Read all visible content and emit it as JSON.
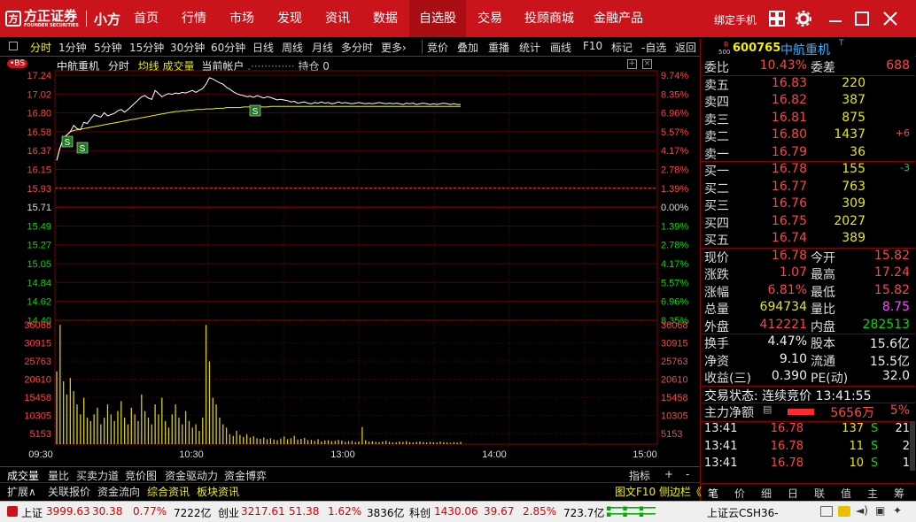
{
  "app": {
    "brand": "方正证券",
    "brand_en": "FOUNDER SECURITIES",
    "sub": "小方"
  },
  "nav": [
    "首页",
    "行情",
    "市场",
    "发现",
    "资讯",
    "数据",
    "自选股",
    "交易",
    "投顾商城",
    "金融产品"
  ],
  "nav_active": 6,
  "topright": {
    "bind_phone": "绑定手机"
  },
  "toolbar": {
    "left": [
      "分时",
      "1分钟",
      "5分钟",
      "15分钟",
      "30分钟",
      "60分钟",
      "日线",
      "周线",
      "月线",
      "多分时",
      "更多›"
    ],
    "right": [
      "竞价",
      "叠加",
      "重播",
      "统计",
      "画线",
      "F10",
      "标记",
      "-自选",
      "返回"
    ]
  },
  "chart_header": {
    "name": "中航重机",
    "mode": "分时",
    "avg": "均线",
    "vol": "成交量",
    "acct": "当前帐户",
    "pos": "持仓 0"
  },
  "chart_data": {
    "type": "line",
    "price_ticks": [
      "17.24",
      "17.02",
      "16.80",
      "16.58",
      "16.37",
      "16.15",
      "15.93",
      "15.71",
      "15.49",
      "15.27",
      "15.05",
      "14.84",
      "14.62",
      "14.40"
    ],
    "pct_ticks": [
      "9.74%",
      "8.35%",
      "6.96%",
      "5.57%",
      "4.17%",
      "2.78%",
      "1.39%",
      "0.00%",
      "1.39%",
      "2.78%",
      "4.17%",
      "5.57%",
      "6.96%",
      "8.35%"
    ],
    "vol_ticks": [
      "36068",
      "30915",
      "25763",
      "20610",
      "15458",
      "10305",
      "5153"
    ],
    "time_ticks": [
      "09:30",
      "10:30",
      "13:00",
      "14:00",
      "15:00"
    ],
    "prev_close": 15.71,
    "price_range": [
      14.18,
      17.24
    ],
    "price": [
      15.9,
      16.1,
      16.25,
      16.3,
      16.35,
      16.45,
      16.4,
      16.38,
      16.5,
      16.48,
      16.55,
      16.62,
      16.6,
      16.58,
      16.65,
      16.6,
      16.62,
      16.64,
      16.68,
      16.7,
      16.66,
      16.7,
      16.75,
      16.8,
      16.85,
      16.9,
      16.92,
      16.88,
      16.86,
      17.0,
      16.95,
      16.9,
      16.93,
      16.95,
      16.94,
      16.96,
      16.95,
      16.97,
      16.96,
      16.98,
      17.0,
      16.97,
      17.0,
      17.03,
      17.1,
      17.2,
      17.18,
      17.15,
      17.12,
      17.1,
      17.05,
      17.02,
      16.98,
      16.95,
      16.93,
      16.92,
      16.9,
      16.91,
      16.89,
      16.92,
      16.9,
      16.88,
      16.9,
      16.89,
      16.87,
      16.85,
      16.86,
      16.85,
      16.84,
      16.82,
      16.83,
      16.8,
      16.81,
      16.82,
      16.8,
      16.79,
      16.81,
      16.8,
      16.82,
      16.8,
      16.81,
      16.79,
      16.8,
      16.82,
      16.8,
      16.81,
      16.8,
      16.79,
      16.8,
      16.81,
      16.8,
      16.79,
      16.8,
      16.79,
      16.8,
      16.81,
      16.8,
      16.79,
      16.8,
      16.79,
      16.8,
      16.79,
      16.78,
      16.8,
      16.79,
      16.8,
      16.78,
      16.79,
      16.8,
      16.79,
      16.78,
      16.79,
      16.78,
      16.79,
      16.8,
      16.79,
      16.78,
      16.79,
      16.78,
      16.78
    ],
    "avg": [
      15.9,
      16.1,
      16.25,
      16.3,
      16.35,
      16.37,
      16.38,
      16.39,
      16.4,
      16.41,
      16.42,
      16.43,
      16.44,
      16.45,
      16.46,
      16.47,
      16.48,
      16.49,
      16.5,
      16.51,
      16.52,
      16.53,
      16.54,
      16.55,
      16.56,
      16.57,
      16.58,
      16.59,
      16.6,
      16.61,
      16.62,
      16.63,
      16.64,
      16.65,
      16.66,
      16.67,
      16.67,
      16.68,
      16.68,
      16.69,
      16.69,
      16.7,
      16.7,
      16.7,
      16.71,
      16.71,
      16.71,
      16.72,
      16.72,
      16.72,
      16.73,
      16.73,
      16.73,
      16.73,
      16.73,
      16.74,
      16.74,
      16.74,
      16.74,
      16.74,
      16.74,
      16.74,
      16.74,
      16.75,
      16.75,
      16.75,
      16.75,
      16.75,
      16.75,
      16.75,
      16.75,
      16.75,
      16.75,
      16.75,
      16.75,
      16.75,
      16.75,
      16.75,
      16.75,
      16.75,
      16.75,
      16.75,
      16.75,
      16.75,
      16.75,
      16.75,
      16.75,
      16.75,
      16.75,
      16.75,
      16.75,
      16.75,
      16.75,
      16.75,
      16.75,
      16.75,
      16.75,
      16.75,
      16.75,
      16.75,
      16.75,
      16.75,
      16.75,
      16.75,
      16.75,
      16.75,
      16.75,
      16.75,
      16.75,
      16.75,
      16.75,
      16.75,
      16.75,
      16.75,
      16.75,
      16.75,
      16.75,
      16.75,
      16.75,
      16.75
    ],
    "volume": [
      22000,
      36000,
      19000,
      15000,
      20000,
      16000,
      12000,
      9000,
      14000,
      8000,
      7000,
      9000,
      11000,
      6000,
      8000,
      12000,
      9000,
      7000,
      10000,
      13000,
      8000,
      6000,
      11000,
      9000,
      7000,
      15000,
      10000,
      8000,
      6000,
      12000,
      9000,
      14000,
      7000,
      5000,
      9000,
      12000,
      8000,
      6000,
      10000,
      7000,
      5000,
      6000,
      4000,
      8000,
      36000,
      25000,
      14000,
      12000,
      8000,
      6000,
      5000,
      3000,
      2500,
      4000,
      2800,
      2200,
      3000,
      2000,
      2400,
      1800,
      1600,
      2000,
      1500,
      1800,
      1400,
      1200,
      1700,
      2300,
      1500,
      1800,
      2500,
      1400,
      1600,
      1900,
      1200,
      1300,
      1000,
      1500,
      800,
      1100,
      1200,
      900,
      1000,
      1300,
      1100,
      700,
      900,
      1000,
      600,
      800,
      5153,
      1200,
      800,
      900,
      700,
      600,
      800,
      1000,
      700,
      500,
      600,
      800,
      700,
      900,
      600,
      500,
      700,
      800,
      600,
      500,
      700,
      600,
      500,
      800,
      600,
      500,
      400,
      600,
      500,
      700
    ]
  },
  "right": {
    "code": "600765",
    "name": "中航重机",
    "r_small": "R",
    "num_small": "500",
    "wb": {
      "label": "委比",
      "val": "10.43%",
      "label2": "委差",
      "val2": "688"
    },
    "sells": [
      {
        "l": "卖五",
        "p": "16.83",
        "v": "220",
        "c": ""
      },
      {
        "l": "卖四",
        "p": "16.82",
        "v": "387",
        "c": ""
      },
      {
        "l": "卖三",
        "p": "16.81",
        "v": "875",
        "c": ""
      },
      {
        "l": "卖二",
        "p": "16.80",
        "v": "1437",
        "c": "+6"
      },
      {
        "l": "卖一",
        "p": "16.79",
        "v": "36",
        "c": ""
      }
    ],
    "buys": [
      {
        "l": "买一",
        "p": "16.78",
        "v": "155",
        "c": "-3"
      },
      {
        "l": "买二",
        "p": "16.77",
        "v": "763",
        "c": ""
      },
      {
        "l": "买三",
        "p": "16.76",
        "v": "309",
        "c": ""
      },
      {
        "l": "买四",
        "p": "16.75",
        "v": "2027",
        "c": ""
      },
      {
        "l": "买五",
        "p": "16.74",
        "v": "389",
        "c": ""
      }
    ],
    "quote": [
      {
        "a": "现价",
        "b": "16.78",
        "c": "今开",
        "d": "15.82",
        "bc": "red",
        "dc": "red"
      },
      {
        "a": "涨跌",
        "b": "1.07",
        "c": "最高",
        "d": "17.24",
        "bc": "red",
        "dc": "red"
      },
      {
        "a": "涨幅",
        "b": "6.81%",
        "c": "最低",
        "d": "15.82",
        "bc": "red",
        "dc": "red"
      },
      {
        "a": "总量",
        "b": "694734",
        "c": "量比",
        "d": "8.75",
        "bc": "yel",
        "dc": "mag"
      },
      {
        "a": "外盘",
        "b": "412221",
        "c": "内盘",
        "d": "282513",
        "bc": "red",
        "dc": "grn"
      }
    ],
    "quote2": [
      {
        "a": "换手",
        "b": "4.47%",
        "c": "股本",
        "d": "15.6亿"
      },
      {
        "a": "净资",
        "b": "9.10",
        "c": "流通",
        "d": "15.5亿"
      },
      {
        "a": "收益(三)",
        "b": "0.390",
        "c": "PE(动)",
        "d": "32.0"
      }
    ],
    "status": "交易状态: 连续竞价 13:41:55",
    "main": {
      "label": "主力净额",
      "val": "5656万",
      "pct": "5%"
    },
    "ticks": [
      {
        "t": "13:41",
        "p": "16.78",
        "v": "137",
        "s": "S",
        "n": "21"
      },
      {
        "t": "13:41",
        "p": "16.78",
        "v": "11",
        "s": "S",
        "n": "2"
      },
      {
        "t": "13:41",
        "p": "16.78",
        "v": "10",
        "s": "S",
        "n": "1"
      }
    ],
    "tabs": [
      "笔",
      "价",
      "细",
      "日",
      "联",
      "值",
      "主",
      "筹"
    ]
  },
  "bottom_tabs": [
    "成交量",
    "量比",
    "买卖力道",
    "竞价图",
    "资金驱动力",
    "资金博弈"
  ],
  "bottom_right": [
    "指标",
    "+",
    "-"
  ],
  "bottom_tabs2": [
    "扩展∧",
    "关联报价",
    "资金流向",
    "综合资讯",
    "板块资讯"
  ],
  "bottom_right2": [
    "图文F10",
    "侧边栏《"
  ],
  "statusbar": {
    "items": [
      {
        "n": "上证",
        "v": "3999.63",
        "c": "30.38",
        "p": "0.77%",
        "a": "7222亿"
      },
      {
        "n": "创业",
        "v": "3217.61",
        "c": "51.38",
        "p": "1.62%",
        "a": "3836亿"
      },
      {
        "n": "科创",
        "v": "1430.06",
        "c": "39.67",
        "p": "2.85%",
        "a": "723.7亿"
      }
    ],
    "ticker": "上证云CSH36-"
  }
}
